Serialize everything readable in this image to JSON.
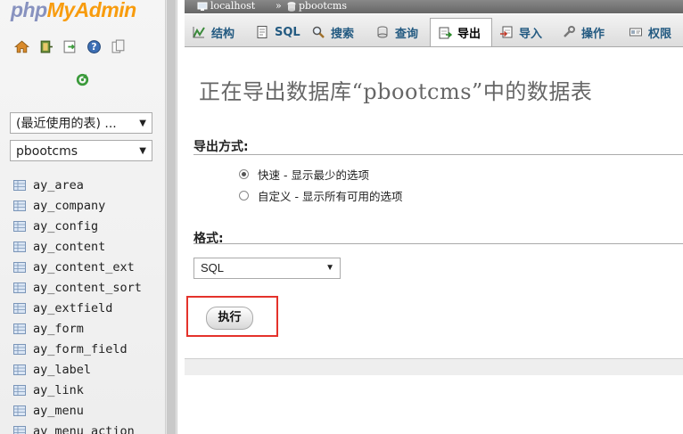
{
  "logo": {
    "php": "php",
    "myadmin": "MyAdmin"
  },
  "nav_icons": [
    "home-icon",
    "exit-icon",
    "sql-window-icon",
    "help-icon",
    "docs-icon"
  ],
  "recent_tables": {
    "label": "(最近使用的表) ..."
  },
  "database_select": {
    "value": "pbootcms"
  },
  "tables": [
    "ay_area",
    "ay_company",
    "ay_config",
    "ay_content",
    "ay_content_ext",
    "ay_content_sort",
    "ay_extfield",
    "ay_form",
    "ay_form_field",
    "ay_label",
    "ay_link",
    "ay_menu",
    "ay_menu_action"
  ],
  "breadcrumb": {
    "server": "localhost",
    "separator": "»",
    "database": "pbootcms"
  },
  "tabs": [
    {
      "label": "结构",
      "icon": "structure-icon"
    },
    {
      "label": "SQL",
      "icon": "sql-icon"
    },
    {
      "label": "搜索",
      "icon": "search-icon"
    },
    {
      "label": "查询",
      "icon": "query-icon"
    },
    {
      "label": "导出",
      "icon": "export-icon"
    },
    {
      "label": "导入",
      "icon": "import-icon"
    },
    {
      "label": "操作",
      "icon": "wrench-icon"
    },
    {
      "label": "权限",
      "icon": "privileges-icon"
    }
  ],
  "page_title": "正在导出数据库“pbootcms”中的数据表",
  "export_method": {
    "label": "导出方式:",
    "options": [
      {
        "label": "快速 - 显示最少的选项",
        "selected": true
      },
      {
        "label": "自定义 - 显示所有可用的选项",
        "selected": false
      }
    ]
  },
  "format": {
    "label": "格式:",
    "value": "SQL"
  },
  "go_button": "执行",
  "colors": {
    "highlight": "#e4322b",
    "tab_text": "#235a81",
    "title": "#666666"
  }
}
